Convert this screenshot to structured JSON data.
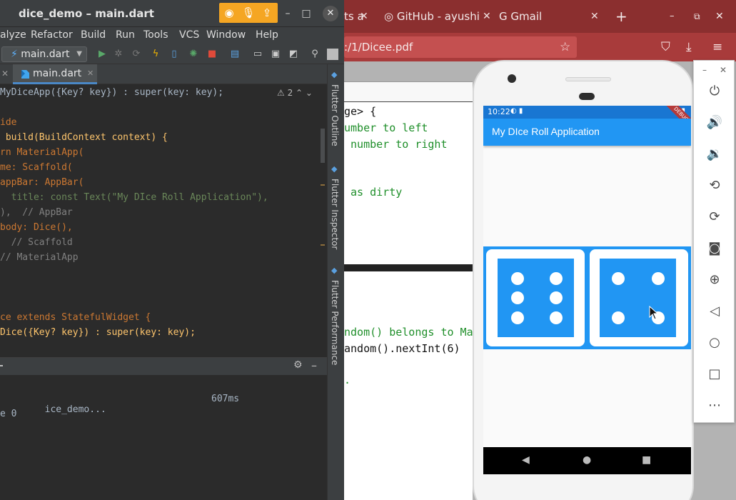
{
  "ide": {
    "window_title": "dice_demo – main.dart",
    "menu": [
      "alyze",
      "Refactor",
      "Build",
      "Run",
      "Tools",
      "VCS",
      "Window",
      "Help"
    ],
    "run_config": "main.dart",
    "tab_label": "main.dart",
    "warning_count": "2",
    "code_lines": [
      "MyDiceApp({Key? key}) : super(key: key);",
      "",
      "ide",
      " build(BuildContext context) {",
      "rn MaterialApp(",
      "me: Scaffold(",
      "appBar: AppBar(",
      "  title: const Text(\"My DIce Roll Application\"),",
      "),  // AppBar",
      "body: Dice(),",
      "  // Scaffold",
      "// MaterialApp",
      "",
      "",
      "",
      "ce extends StatefulWidget {",
      "Dice({Key? key}) : super(key: key);"
    ],
    "side_tools": [
      "Flutter Outline",
      "Flutter Inspector",
      "Flutter Performance"
    ],
    "console": {
      "line1_left": "ice_demo...",
      "line1_right": "607ms",
      "line2": "e 0"
    }
  },
  "browser": {
    "tabs": [
      {
        "label": "ts a",
        "icon": "tab-fragment"
      },
      {
        "label": "GitHub - ayushi",
        "icon": "github-icon"
      },
      {
        "label": "Gmail",
        "icon": "google-icon"
      }
    ],
    "new_tab": "+",
    "url": ":/1/Dicee.pdf",
    "pdf_lines": [
      {
        "text": "ge> {",
        "color": "black"
      },
      {
        "text": "umber to left",
        "color": "green"
      },
      {
        "text": " number to right",
        "color": "green"
      },
      {
        "text": "",
        "color": "green"
      },
      {
        "text": "",
        "color": "green"
      },
      {
        "text": " as dirty",
        "color": "green"
      },
      {
        "text": "",
        "color": "green"
      },
      {
        "text": "",
        "color": "green"
      },
      {
        "text": "",
        "color": "green"
      },
      {
        "text": "",
        "color": "green"
      },
      {
        "text": "",
        "color": "green"
      },
      {
        "text": "",
        "color": "green"
      },
      {
        "text": "",
        "color": "green"
      },
      {
        "text": "ndom() belongs to Ma",
        "color": "green"
      },
      {
        "text": "andom().nextInt(6)",
        "color": "green"
      },
      {
        "text": "",
        "color": "green"
      },
      {
        "text": ".",
        "color": "green"
      }
    ]
  },
  "phone": {
    "status_time": "10:22",
    "app_title": "My DIce Roll Application",
    "debug_banner": "DEBUG",
    "left_die_value": 6,
    "right_die_value": 4
  },
  "colors": {
    "accent": "#2196f3",
    "status_bar": "#1976d2",
    "browser_chrome": "#8b2f2f",
    "ide_bg": "#2b2b2b"
  }
}
